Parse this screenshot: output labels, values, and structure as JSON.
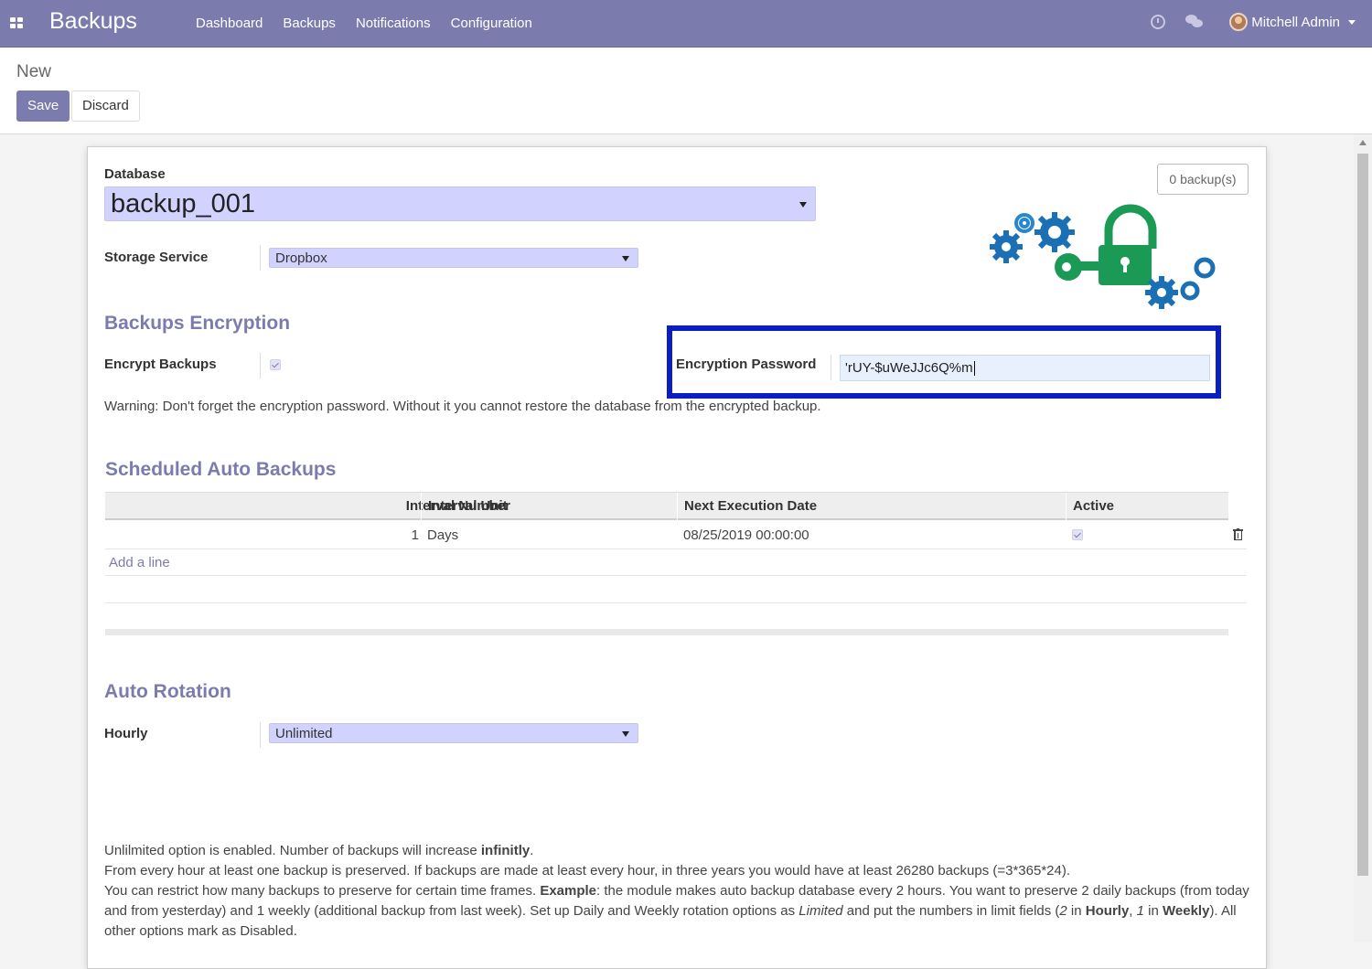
{
  "navbar": {
    "app_title": "Backups",
    "menu": [
      "Dashboard",
      "Backups",
      "Notifications",
      "Configuration"
    ],
    "user_name": "Mitchell Admin",
    "color": "#7c7bad"
  },
  "control_panel": {
    "breadcrumb": "New",
    "save_label": "Save",
    "discard_label": "Discard"
  },
  "form": {
    "stat_button": "0 backup(s)",
    "database": {
      "label": "Database",
      "value": "backup_001"
    },
    "storage_service": {
      "label": "Storage Service",
      "value": "Dropbox"
    },
    "encryption": {
      "title": "Backups Encryption",
      "encrypt_label": "Encrypt Backups",
      "encrypt_checked": true,
      "password_label": "Encryption Password",
      "password_value": "'rUY-$uWeJJc6Q%m",
      "warning": "Warning: Don't forget the encryption password. Without it you cannot restore the database from the encrypted backup."
    },
    "scheduled": {
      "title": "Scheduled Auto Backups",
      "columns": [
        "Interval Number",
        "Interval Unit",
        "Next Execution Date",
        "Active"
      ],
      "rows": [
        {
          "interval_number": "1",
          "interval_unit": "Days",
          "next_execution": "08/25/2019 00:00:00",
          "active": true
        }
      ],
      "add_line": "Add a line"
    },
    "rotation": {
      "title": "Auto Rotation",
      "hourly_label": "Hourly",
      "hourly_value": "Unlimited"
    },
    "notes": {
      "line1_pre": "Unlilmited option is enabled. Number of backups will increase ",
      "line1_bold": "infinitly",
      "line1_post": ".",
      "line2": "From every hour at least one backup is preserved. If backups are made at least every hour, in three years you would have at least 26280 backups (=3*365*24).",
      "line3_pre": "You can restrict how many backups to preserve for certain time frames. ",
      "line3_bold": "Example",
      "line3_post": ": the module makes auto backup database every 2 hours. You want to preserve 2 daily backups (from today and from yesterday) and 1 weekly (additional backup from last week). Set up Daily and Weekly rotation options as ",
      "line3_em": "Limited",
      "line3_post2": " and put the numbers in limit fields (",
      "line3_em2": "2",
      "line3_in1": " in ",
      "line3_bold2": "Hourly",
      "line3_comma": ", ",
      "line3_em3": "1",
      "line3_in2": " in ",
      "line3_bold3": "Weekly",
      "line3_end": "). All other options mark as Disabled."
    }
  },
  "colors": {
    "gear_blue": "#1a6fb5",
    "lock_green": "#1a9a55",
    "highlight": "#0b1ec2"
  }
}
